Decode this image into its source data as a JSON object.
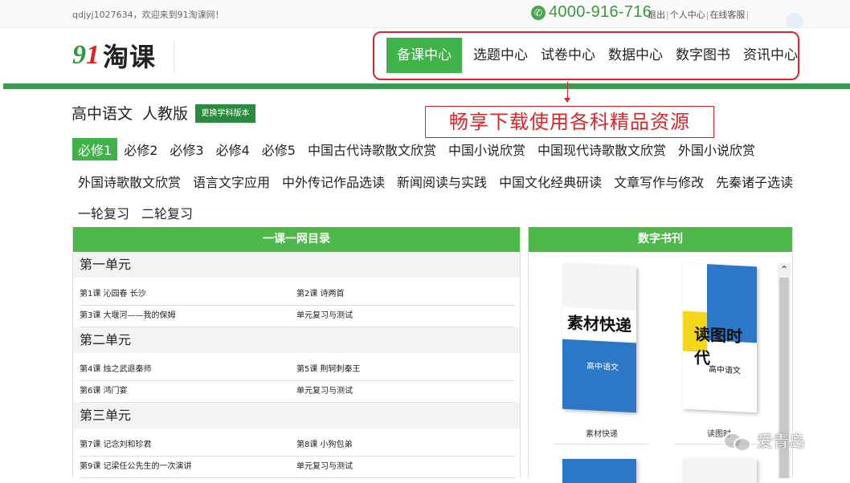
{
  "topbar": {
    "welcome": "qdjyj1027634，欢迎来到91淘课网！",
    "phone": "4000-916-716",
    "links": [
      "退出",
      "个人中心",
      "在线客服"
    ]
  },
  "logo": {
    "digits_9": "9",
    "digits_1": "1",
    "text": "淘课"
  },
  "nav": {
    "items": [
      "备课中心",
      "选题中心",
      "试卷中心",
      "数据中心",
      "数字图书",
      "资讯中心"
    ],
    "active_index": 0
  },
  "subject": {
    "name": "高中语文",
    "version": "人教版",
    "change_label": "更换学科版本"
  },
  "promo": "畅享下载使用各科精品资源",
  "categories": {
    "row1": [
      "必修1",
      "必修2",
      "必修3",
      "必修4",
      "必修5",
      "中国古代诗歌散文欣赏",
      "中国小说欣赏",
      "中国现代诗歌散文欣赏",
      "外国小说欣赏"
    ],
    "row2": [
      "外国诗歌散文欣赏",
      "语言文字应用",
      "中外传记作品选读",
      "新闻阅读与实践",
      "中国文化经典研读",
      "文章写作与修改",
      "先秦诸子选读"
    ],
    "row3": [
      "一轮复习",
      "二轮复习"
    ]
  },
  "catalog": {
    "title": "一课一网目录",
    "units": [
      {
        "title": "第一单元",
        "rows": [
          [
            "第1课 沁园春 长沙",
            "第2课 诗两首"
          ],
          [
            "第3课 大堰河——我的保姆",
            "单元复习与测试"
          ]
        ]
      },
      {
        "title": "第二单元",
        "rows": [
          [
            "第4课 烛之武退秦师",
            "第5课 荆轲刺秦王"
          ],
          [
            "第6课 鸿门宴",
            "单元复习与测试"
          ]
        ]
      },
      {
        "title": "第三单元",
        "rows": [
          [
            "第7课 记念刘和珍君",
            "第8课 小狗包弟"
          ],
          [
            "第9课 记梁任公先生的一次演讲",
            "单元复习与测试"
          ]
        ]
      }
    ]
  },
  "books": {
    "title": "数字书刊",
    "items": [
      {
        "cover_title": "素材快递",
        "cover_sub": "高中语文",
        "label": "素材快递"
      },
      {
        "cover_title": "读图时代",
        "cover_sub": "高中语文",
        "label": "读图时"
      }
    ]
  },
  "watermark": "爱青岛",
  "colors": {
    "accent_green": "#3fb24a",
    "red_highlight": "#d9262b",
    "phone_green": "#3c9a3c",
    "book_blue": "#2c77c7"
  }
}
